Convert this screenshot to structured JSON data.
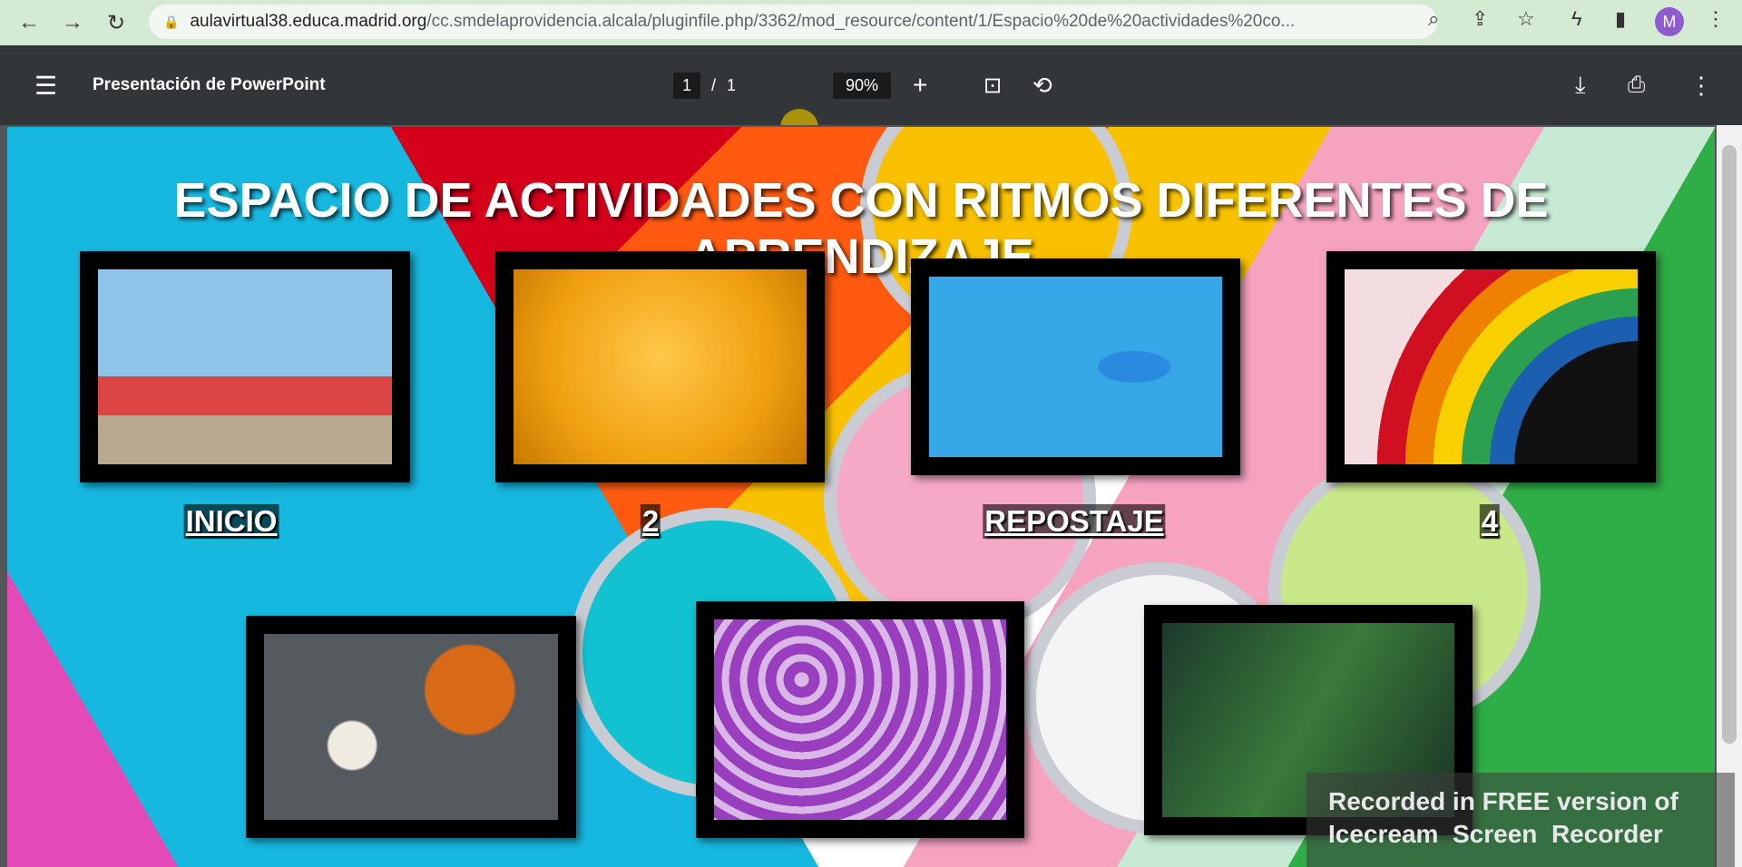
{
  "browser": {
    "url_host": "aulavirtual38.educa.madrid.org",
    "url_path": "/cc.smdelaprovidencia.alcala/pluginfile.php/3362/mod_resource/content/1/Espacio%20de%20actividades%20co...",
    "avatar": "M"
  },
  "pdf": {
    "title": "Presentación de PowerPoint",
    "page_current": "1",
    "page_sep": "/",
    "page_total": "1",
    "zoom": "90%"
  },
  "slide": {
    "title": "ESPACIO DE ACTIVIDADES CON RITMOS DIFERENTES DE APRENDIZAJE",
    "labels": [
      "INICIO",
      "2",
      "REPOSTAJE",
      "4"
    ]
  },
  "watermark": {
    "line1": "Recorded in FREE version of",
    "line2": "Icecream  Screen  Recorder"
  }
}
